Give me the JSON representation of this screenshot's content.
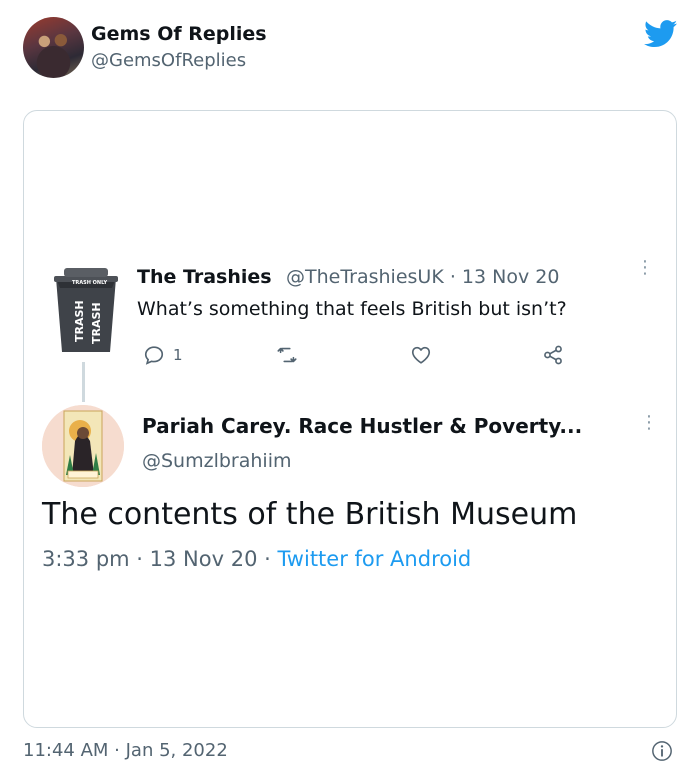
{
  "outer": {
    "name": "Gems Of Replies",
    "handle": "@GemsOfReplies",
    "timestamp": "11:44 AM · Jan 5, 2022"
  },
  "quoted": {
    "tweet1": {
      "name": "The Trashies",
      "handle_date": "@TheTrashiesUK · 13 Nov 20",
      "text": "What’s something that feels British but isn’t?",
      "reply_count": "1",
      "avatar_label_top": "TRASH ONLY",
      "avatar_label_side": "TRASH"
    },
    "tweet2": {
      "name": "Pariah Carey. Race Hustler & Poverty...",
      "handle": "@Sumzlbrahiim",
      "text": "The contents of the British Museum",
      "meta_time": "3:33 pm · 13 Nov 20 · ",
      "meta_source": "Twitter for Android"
    }
  },
  "icons": {
    "bird": "twitter-bird-icon",
    "reply": "reply-icon",
    "retweet": "retweet-icon",
    "like": "heart-icon",
    "share": "share-icon",
    "more": "more-icon",
    "info": "info-icon"
  },
  "colors": {
    "accent": "#1d9bf0",
    "secondary_text": "#536471",
    "border": "#cfd9de"
  }
}
